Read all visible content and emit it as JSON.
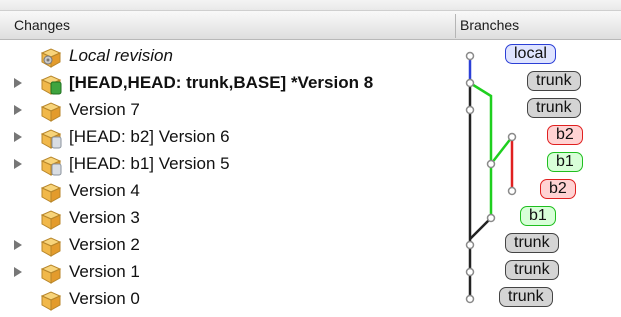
{
  "header": {
    "changes_label": "Changes",
    "branches_label": "Branches"
  },
  "rows": [
    {
      "label": "Local revision",
      "style": "italic",
      "expandable": false,
      "icon": "local-revision-icon"
    },
    {
      "label": "[HEAD,HEAD: trunk,BASE] *Version 8",
      "style": "bold",
      "expandable": true,
      "icon": "head-revision-icon"
    },
    {
      "label": "Version 7",
      "style": "normal",
      "expandable": true,
      "icon": "revision-box-icon"
    },
    {
      "label": "[HEAD: b2] Version 6",
      "style": "normal",
      "expandable": true,
      "icon": "branch-head-revision-icon"
    },
    {
      "label": "[HEAD: b1] Version 5",
      "style": "normal",
      "expandable": true,
      "icon": "branch-head-revision-icon"
    },
    {
      "label": "Version 4",
      "style": "normal",
      "expandable": false,
      "icon": "revision-box-icon"
    },
    {
      "label": "Version 3",
      "style": "normal",
      "expandable": false,
      "icon": "revision-box-icon"
    },
    {
      "label": "Version 2",
      "style": "normal",
      "expandable": true,
      "icon": "revision-box-icon"
    },
    {
      "label": "Version 1",
      "style": "normal",
      "expandable": true,
      "icon": "revision-box-icon"
    },
    {
      "label": "Version 0",
      "style": "normal",
      "expandable": false,
      "icon": "revision-box-icon"
    }
  ],
  "branch_badges": [
    {
      "label": "local",
      "kind": "local"
    },
    {
      "label": "trunk",
      "kind": "trunk"
    },
    {
      "label": "trunk",
      "kind": "trunk"
    },
    {
      "label": "b2",
      "kind": "b2"
    },
    {
      "label": "b1",
      "kind": "b1"
    },
    {
      "label": "b2",
      "kind": "b2"
    },
    {
      "label": "b1",
      "kind": "b1"
    },
    {
      "label": "trunk",
      "kind": "trunk"
    },
    {
      "label": "trunk",
      "kind": "trunk"
    },
    {
      "label": "trunk",
      "kind": "trunk"
    }
  ],
  "colors": {
    "local": "#2b3fd6",
    "trunk": "#222222",
    "b1": "#1fcf1f",
    "b2": "#e02020",
    "node": "#8a8a8a"
  }
}
